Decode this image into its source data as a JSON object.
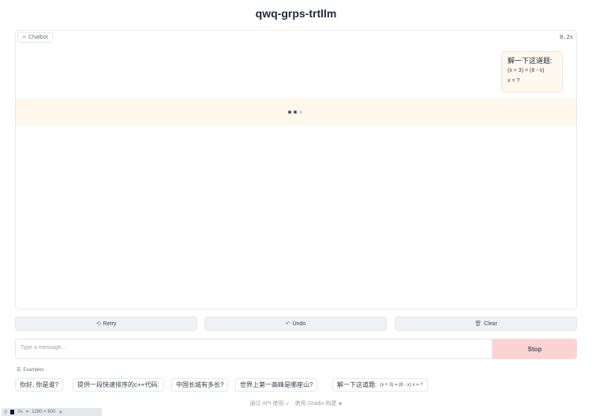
{
  "app": {
    "title": "qwq-grps-trtllm"
  },
  "chatbot": {
    "label": "Chatbot",
    "label_icon": "chat-icon",
    "timer": "0.2s",
    "user_message": {
      "line1": "解一下这道题:",
      "line2": "(x + 3) = (8 - x)",
      "line3": "x = ?"
    },
    "bot_status": "loading"
  },
  "actions": {
    "retry": "Retry",
    "undo": "Undo",
    "clear": "Clear"
  },
  "input": {
    "placeholder": "Type a message...",
    "stop": "Stop"
  },
  "examples": {
    "label": "Examples",
    "items": [
      "你好, 你是谁?",
      "提供一段快速排序的c++代码:",
      "中国长城有多长?",
      "世界上第一高峰是哪座山?"
    ],
    "last": {
      "text": "解一下这道题:",
      "detail": "(x + 3) = (8 - x) x = ?"
    }
  },
  "footer": {
    "api_text": "通过 API 使用",
    "sep": "·",
    "built_text": "使用 Gradio 构建"
  },
  "devtools": {
    "time": "0s",
    "size": "1280 × 800"
  },
  "colors": {
    "bubble": "#fff8ef",
    "pending": "#fdf7ec",
    "stop": "#fbd3d3"
  }
}
